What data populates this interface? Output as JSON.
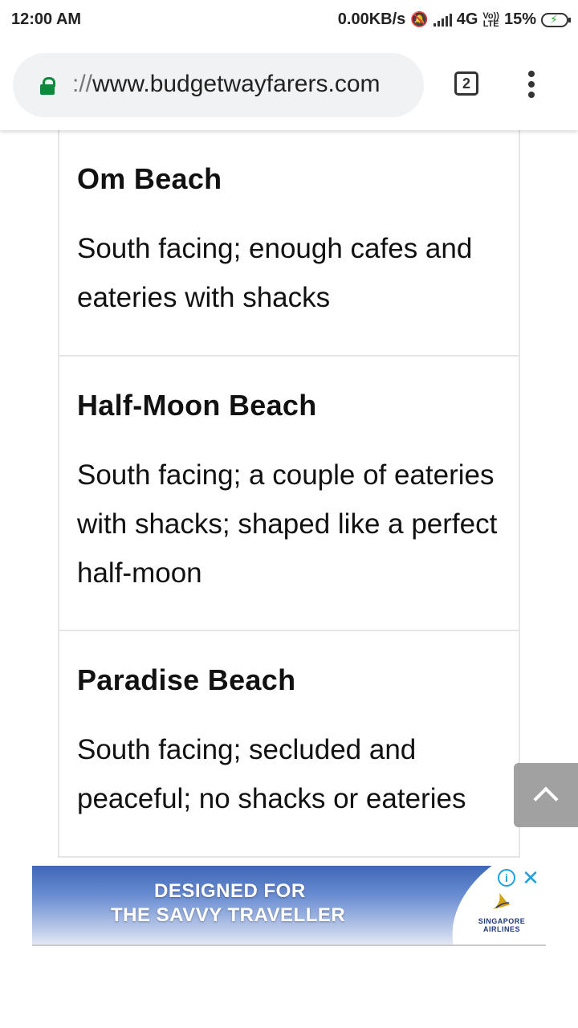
{
  "status_bar": {
    "time": "12:00 AM",
    "net_speed": "0.00KB/s",
    "network": "4G",
    "volte_top": "Vo))",
    "volte_bottom": "LTE",
    "battery": "15%"
  },
  "browser": {
    "url_scheme": "://",
    "url_host": "www.budgetwayfarers.com",
    "tab_count": "2"
  },
  "beaches": [
    {
      "name": "Om Beach",
      "desc": "South facing; enough cafes and eateries with shacks"
    },
    {
      "name": "Half-Moon Beach",
      "desc": "South facing; a couple of eateries with shacks; shaped like a perfect half-moon"
    },
    {
      "name": "Paradise Beach",
      "desc": "South facing; secluded and peaceful; no shacks or eateries"
    }
  ],
  "ad": {
    "line1": "DESIGNED FOR",
    "line2": "THE SAVVY TRAVELLER",
    "brand_top": "SINGAPORE",
    "brand_bottom": "AIRLINES",
    "info_glyph": "i",
    "close_glyph": "✕"
  }
}
